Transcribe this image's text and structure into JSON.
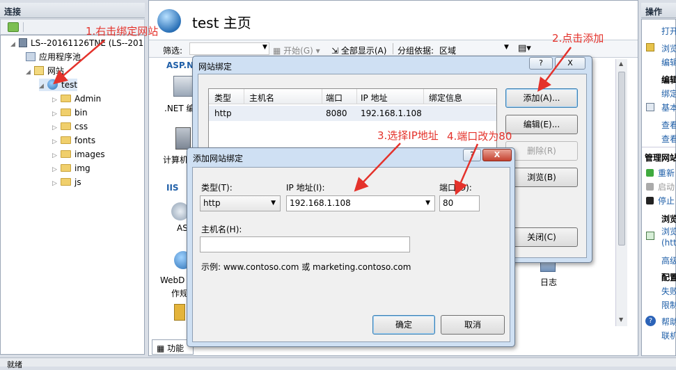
{
  "left_panel": {
    "title": "连接",
    "tree": [
      {
        "label": "LS--20161126TNE (LS--201",
        "level": 0
      },
      {
        "label": "应用程序池",
        "level": 1
      },
      {
        "label": "网站",
        "level": 1
      },
      {
        "label": "test",
        "level": 2
      },
      {
        "label": "Admin",
        "level": 3
      },
      {
        "label": "bin",
        "level": 3
      },
      {
        "label": "css",
        "level": 3
      },
      {
        "label": "fonts",
        "level": 3
      },
      {
        "label": "images",
        "level": 3
      },
      {
        "label": "img",
        "level": 3
      },
      {
        "label": "js",
        "level": 3
      }
    ]
  },
  "main": {
    "title": "test 主页",
    "filter_label": "筛选:",
    "start_label": "开始(G)",
    "show_all_label": "全部显示(A)",
    "group_by_label": "分组依据:",
    "group_by_value": "区域",
    "section_aspnet": "ASP.N",
    "net_label": ".NET 编",
    "calc_label": "计算机",
    "section_iis": "IIS",
    "as_label": "AS",
    "webd_label": "WebD",
    "webd_label2": "作规",
    "log_label": "日志",
    "bottom_tab": "功能"
  },
  "right_panel": {
    "title": "操作",
    "items": [
      {
        "text": "打开",
        "kind": "link"
      },
      {
        "text": "浏览",
        "kind": "link"
      },
      {
        "text": "编辑",
        "kind": "link"
      },
      {
        "text": "编辑",
        "kind": "header"
      },
      {
        "text": "绑定",
        "kind": "link"
      },
      {
        "text": "基本",
        "kind": "link"
      },
      {
        "text": "查看",
        "kind": "link"
      },
      {
        "text": "查看",
        "kind": "link"
      },
      {
        "text": "管理网站",
        "kind": "header"
      },
      {
        "text": "重新",
        "kind": "link"
      },
      {
        "text": "启动",
        "kind": "disabled"
      },
      {
        "text": "停止",
        "kind": "link"
      },
      {
        "text": "浏览",
        "kind": "header"
      },
      {
        "text": "浏览",
        "kind": "link"
      },
      {
        "text": "(htt",
        "kind": "link"
      },
      {
        "text": "高级",
        "kind": "link"
      },
      {
        "text": "配置",
        "kind": "header"
      },
      {
        "text": "失败",
        "kind": "link"
      },
      {
        "text": "限制",
        "kind": "link"
      },
      {
        "text": "帮助",
        "kind": "link"
      },
      {
        "text": "联机",
        "kind": "link"
      }
    ]
  },
  "status_bar": {
    "text": "就绪"
  },
  "site_bindings": {
    "title": "网站绑定",
    "columns": [
      "类型",
      "主机名",
      "端口",
      "IP 地址",
      "绑定信息"
    ],
    "rows": [
      [
        "http",
        "",
        "8080",
        "192.168.1.108",
        ""
      ]
    ],
    "add_label": "添加(A)...",
    "edit_label": "编辑(E)...",
    "remove_label": "删除(R)",
    "browse_label": "浏览(B)",
    "close_label": "关闭(C)",
    "help_glyph": "?",
    "close_glyph": "X"
  },
  "add_binding": {
    "title": "添加网站绑定",
    "type_label": "类型(T):",
    "type_value": "http",
    "ip_label": "IP 地址(I):",
    "ip_value": "192.168.1.108",
    "port_label": "端口(O):",
    "port_value": "80",
    "host_label": "主机名(H):",
    "host_value": "",
    "example": "示例: www.contoso.com 或 marketing.contoso.com",
    "ok_label": "确定",
    "cancel_label": "取消",
    "help_glyph": "?",
    "close_glyph": "X"
  },
  "annotations": {
    "a1": "1.右击绑定网站",
    "a2": "2.点击添加",
    "a3": "3.选择IP地址",
    "a4": "4.端口改为80"
  },
  "colors": {
    "annotation": "#e4322b",
    "link": "#1f5fa8",
    "titlebar": "#cfe0f3"
  }
}
